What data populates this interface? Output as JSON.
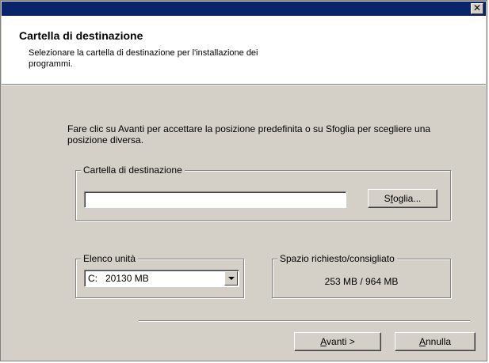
{
  "window": {
    "close_glyph": "✕"
  },
  "header": {
    "title": "Cartella di destinazione",
    "subtitle": "Selezionare la cartella di destinazione per l'installazione dei programmi."
  },
  "main": {
    "intro": "Fare clic su Avanti per accettare la posizione predefinita o su Sfoglia per scegliere una posizione diversa.",
    "destination_group": {
      "legend": "Cartella di destinazione",
      "path_value": "",
      "browse_label_pre": "S",
      "browse_label_ul": "f",
      "browse_label_post": "oglia..."
    },
    "drive_group": {
      "legend": "Elenco unità",
      "selected": "C:   20130 MB"
    },
    "space_group": {
      "legend": "Spazio richiesto/consigliato",
      "value": "253 MB / 964 MB"
    }
  },
  "footer": {
    "next_ul": "A",
    "next_rest": "vanti >",
    "cancel_ul": "A",
    "cancel_rest": "nnulla"
  },
  "colors": {
    "titlebar": "#0a246a",
    "dialog_face": "#d4d0c8",
    "header_bg": "#ffffff"
  },
  "icons": [
    "close-icon",
    "dropdown-arrow-icon"
  ]
}
